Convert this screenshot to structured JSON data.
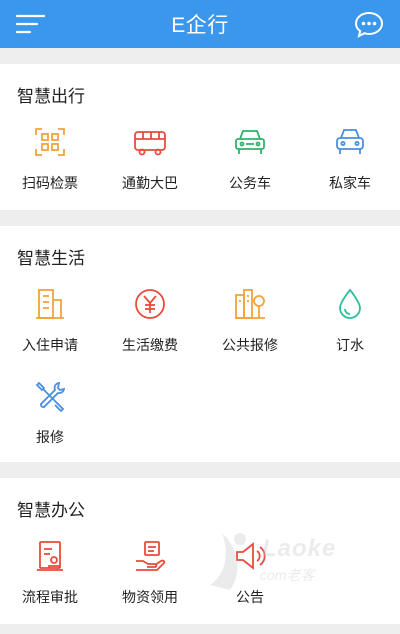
{
  "header": {
    "title": "E企行"
  },
  "colors": {
    "header": "#3b97eb",
    "orange": "#f2a33a",
    "red": "#e84b3c",
    "green": "#2fb36b",
    "blue": "#4a8fe0",
    "teal": "#2cbf9c"
  },
  "sections": [
    {
      "title": "智慧出行",
      "items": [
        {
          "label": "扫码检票",
          "icon": "qr-scan-icon"
        },
        {
          "label": "通勤大巴",
          "icon": "bus-icon"
        },
        {
          "label": "公务车",
          "icon": "official-car-icon"
        },
        {
          "label": "私家车",
          "icon": "private-car-icon"
        }
      ]
    },
    {
      "title": "智慧生活",
      "items": [
        {
          "label": "入住申请",
          "icon": "building-icon"
        },
        {
          "label": "生活缴费",
          "icon": "yen-coin-icon"
        },
        {
          "label": "公共报修",
          "icon": "public-repair-icon"
        },
        {
          "label": "订水",
          "icon": "water-drop-icon"
        },
        {
          "label": "报修",
          "icon": "tools-icon"
        }
      ]
    },
    {
      "title": "智慧办公",
      "items": [
        {
          "label": "流程审批",
          "icon": "approval-icon"
        },
        {
          "label": "物资领用",
          "icon": "supplies-icon"
        },
        {
          "label": "公告",
          "icon": "megaphone-icon"
        }
      ]
    }
  ],
  "watermark": {
    "brand": "Laoke",
    "sub": "com老客"
  }
}
